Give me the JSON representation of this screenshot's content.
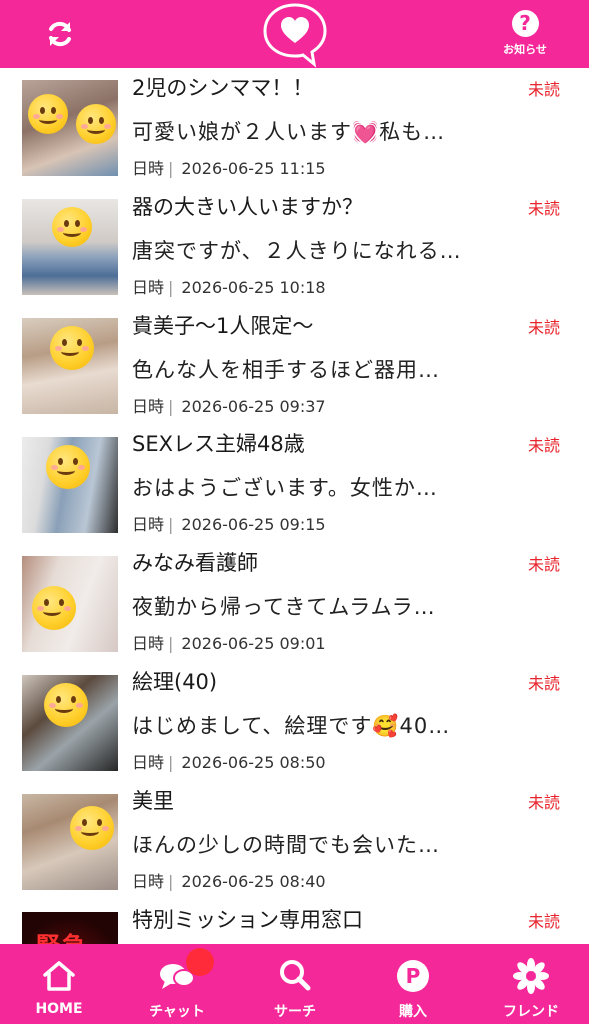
{
  "header": {
    "refresh_icon": "refresh-icon",
    "logo_icon": "heart-speech-bubble-icon",
    "help_label": "お知らせ",
    "help_icon": "question-icon",
    "brand_color": "#f5289a"
  },
  "messages": [
    {
      "title": "2児のシンママ！！",
      "status": "未読",
      "preview": "可愛い娘が２人います💓私も…",
      "date_label": "日時",
      "datetime": "2026-06-25 11:15"
    },
    {
      "title": "器の大きい人いますか？",
      "status": "未読",
      "preview": "唐突ですが、２人きりになれる…",
      "date_label": "日時",
      "datetime": "2026-06-25 10:18"
    },
    {
      "title": "貴美子〜1人限定〜",
      "status": "未読",
      "preview": "色んな人を相手するほど器用…",
      "date_label": "日時",
      "datetime": "2026-06-25 09:37"
    },
    {
      "title": "SEXレス主婦48歳",
      "status": "未読",
      "preview": "おはようございます。女性か…",
      "date_label": "日時",
      "datetime": "2026-06-25 09:15"
    },
    {
      "title": "みなみ看護師",
      "status": "未読",
      "preview": "夜勤から帰ってきてムラムラ…",
      "date_label": "日時",
      "datetime": "2026-06-25 09:01"
    },
    {
      "title": "絵理(40)",
      "status": "未読",
      "preview": "はじめまして、絵理です🥰40…",
      "date_label": "日時",
      "datetime": "2026-06-25 08:50"
    },
    {
      "title": "美里",
      "status": "未読",
      "preview": "ほんの少しの時間でも会いた…",
      "date_label": "日時",
      "datetime": "2026-06-25 08:40"
    },
    {
      "title": "特別ミッション専用窓口",
      "status": "未読",
      "preview": "",
      "date_label": "",
      "datetime": ""
    }
  ],
  "thumb_partial_text": "緊急",
  "unread_color": "#e8232b",
  "bottom_nav": [
    {
      "label": "HOME",
      "icon": "home-icon"
    },
    {
      "label": "チャット",
      "icon": "chat-icon"
    },
    {
      "label": "サーチ",
      "icon": "search-icon"
    },
    {
      "label": "購入",
      "icon": "purchase-p-icon"
    },
    {
      "label": "フレンド",
      "icon": "flower-icon"
    }
  ]
}
